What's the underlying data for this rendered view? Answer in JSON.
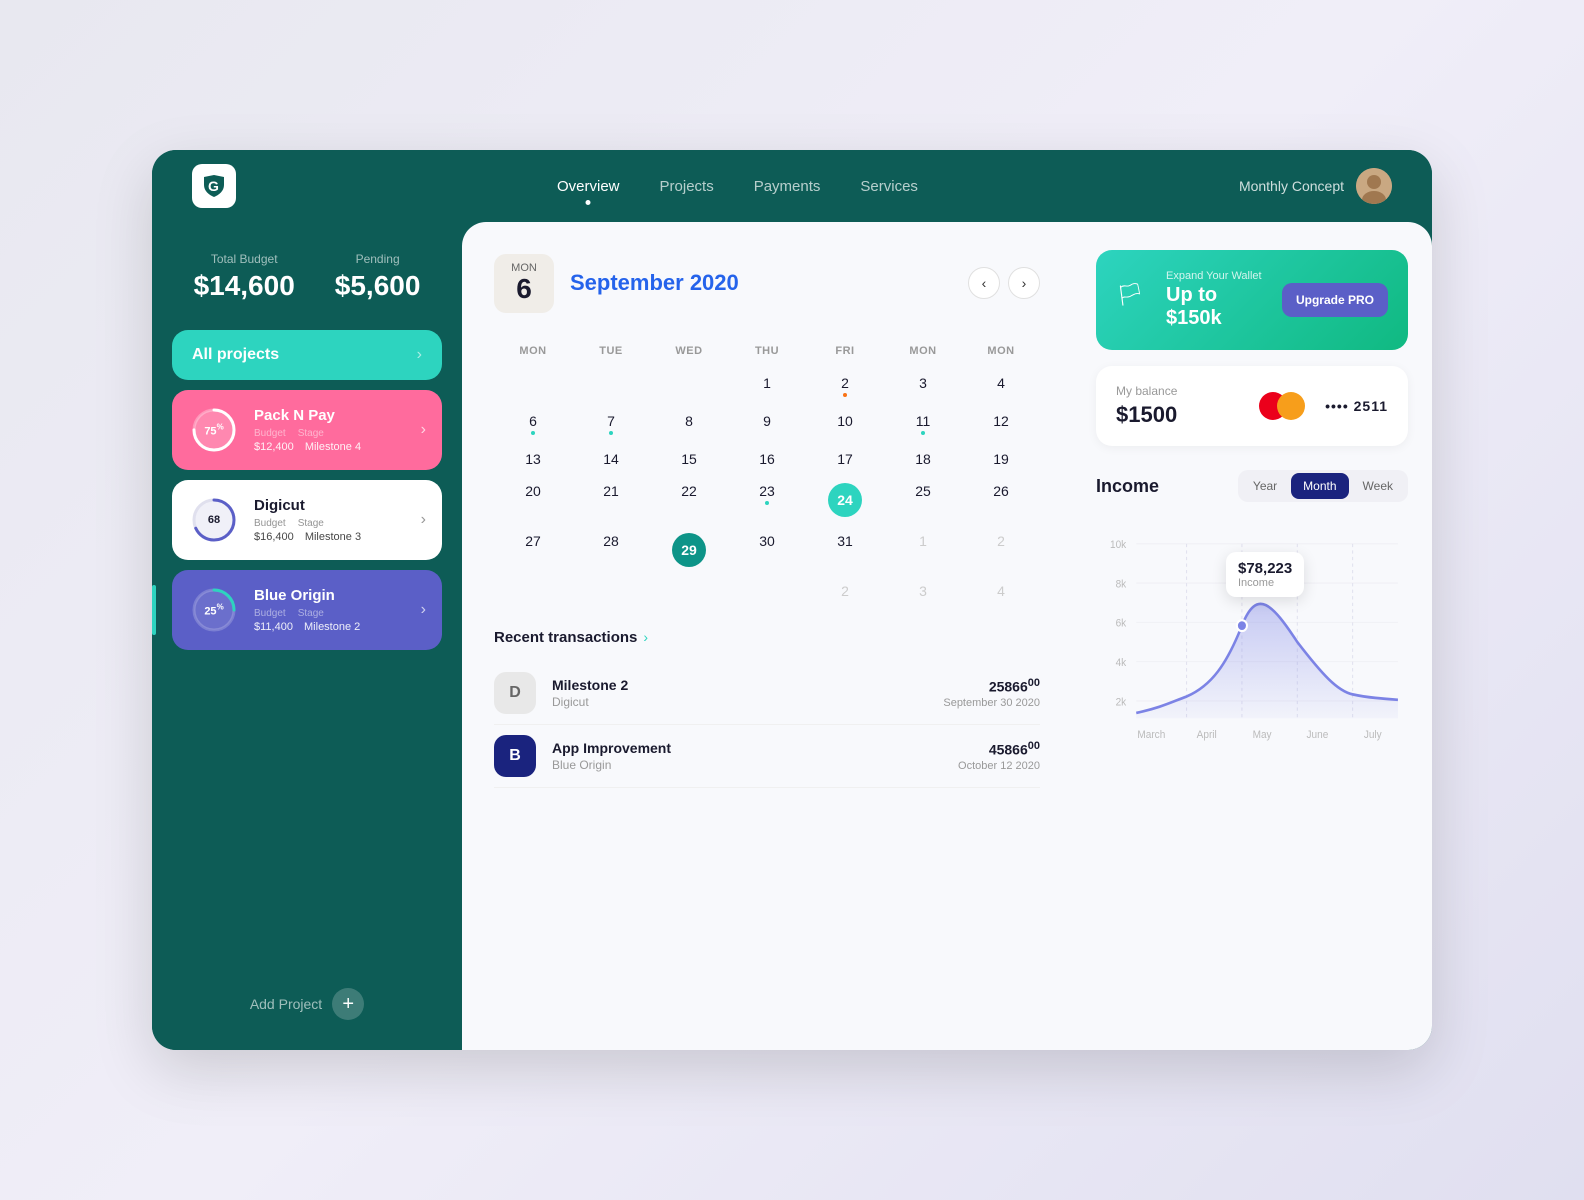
{
  "app": {
    "logo_alt": "G logo"
  },
  "nav": {
    "links": [
      {
        "label": "Overview",
        "active": true
      },
      {
        "label": "Projects",
        "active": false
      },
      {
        "label": "Payments",
        "active": false
      },
      {
        "label": "Services",
        "active": false
      }
    ],
    "user_label": "Monthly Concept"
  },
  "sidebar": {
    "total_budget_label": "Total Budget",
    "total_budget_value": "$14,600",
    "pending_label": "Pending",
    "pending_value": "$5,600",
    "projects": [
      {
        "id": "all",
        "name": "All projects",
        "type": "all"
      },
      {
        "id": "pack-n-pay",
        "name": "Pack N Pay",
        "progress": 75,
        "budget_label": "Budget",
        "budget_value": "$12,400",
        "stage_label": "Stage",
        "stage_value": "Milestone 4",
        "type": "pink"
      },
      {
        "id": "digicut",
        "name": "Digicut",
        "progress": 68,
        "budget_label": "Budget",
        "budget_value": "$16,400",
        "stage_label": "Stage",
        "stage_value": "Milestone 3",
        "type": "white"
      },
      {
        "id": "blue-origin",
        "name": "Blue Origin",
        "progress": 25,
        "budget_label": "Budget",
        "budget_value": "$11,400",
        "stage_label": "Stage",
        "stage_value": "Milestone 2",
        "type": "purple",
        "active": true
      }
    ],
    "add_project_label": "Add Project"
  },
  "calendar": {
    "day_name": "Mon",
    "day_num": "6",
    "month_year": "September 2020",
    "days_header": [
      "MON",
      "TUE",
      "WED",
      "THU",
      "FRI",
      "MON",
      "MON"
    ],
    "weeks": [
      [
        "",
        "",
        "",
        "1",
        "2",
        "3",
        "4"
      ],
      [
        "6",
        "7",
        "8",
        "9",
        "10",
        "11",
        "12"
      ],
      [
        "13",
        "14",
        "15",
        "16",
        "17",
        "18",
        "19"
      ],
      [
        "20",
        "21",
        "22",
        "23",
        "24",
        "25",
        "26"
      ],
      [
        "27",
        "28",
        "29",
        "30",
        "31",
        "1",
        "2"
      ],
      [
        "",
        "",
        "",
        "",
        "2",
        "3",
        "4"
      ]
    ],
    "today": "24",
    "selected": "29",
    "dots": [
      "2",
      "6",
      "7",
      "11",
      "23"
    ],
    "dot_colors": {
      "2": "orange",
      "6": "green",
      "7": "green",
      "11": "green",
      "23": "green"
    }
  },
  "transactions": {
    "title": "Recent transactions",
    "items": [
      {
        "icon": "D",
        "name": "Milestone 2",
        "project": "Digicut",
        "amount": "25866",
        "cents": "00",
        "date": "September 30 2020",
        "type": "d"
      },
      {
        "icon": "B",
        "name": "App Improvement",
        "project": "Blue Origin",
        "amount": "45866",
        "cents": "00",
        "date": "October 12 2020",
        "type": "b"
      }
    ]
  },
  "wallet": {
    "label": "Expand Your Wallet",
    "value": "Up to $150k",
    "upgrade_btn": "Upgrade PRO"
  },
  "balance": {
    "label": "My balance",
    "value": "$1500",
    "card_number": "•••• 2511"
  },
  "income": {
    "title": "Income",
    "periods": [
      {
        "label": "Year",
        "active": false
      },
      {
        "label": "Month",
        "active": true
      },
      {
        "label": "Week",
        "active": false
      }
    ],
    "chart": {
      "labels": [
        "March",
        "April",
        "May",
        "June",
        "July"
      ],
      "y_axis": [
        "10k",
        "8k",
        "6k",
        "4k",
        "2k"
      ],
      "tooltip_value": "$78,223",
      "tooltip_label": "Income"
    }
  }
}
